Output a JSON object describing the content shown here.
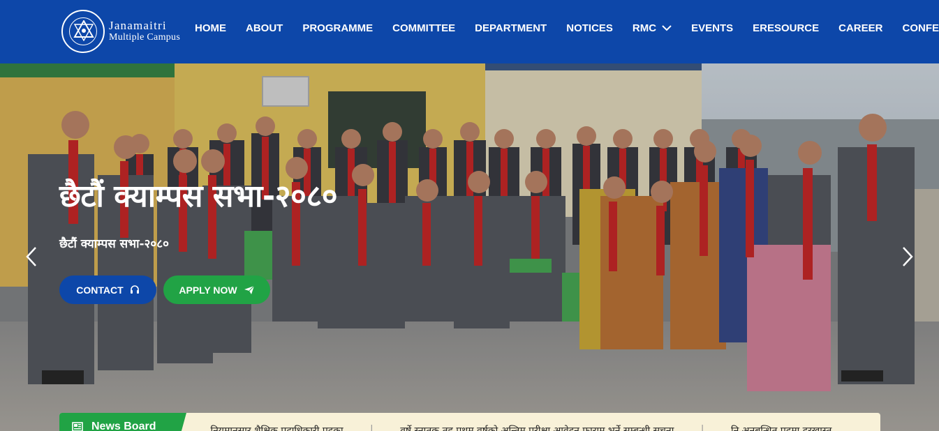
{
  "logo": {
    "line1": "Janamaitri",
    "line2": "Multiple Campus"
  },
  "nav": {
    "items": [
      "HOME",
      "ABOUT",
      "PROGRAMME",
      "COMMITTEE",
      "DEPARTMENT",
      "NOTICES",
      "RMC",
      "EVENTS",
      "ERESOURCE",
      "CAREER",
      "CONFERENCE"
    ]
  },
  "hero": {
    "title": "छैटौं क्याम्पस सभा-२०८०",
    "subtitle": "छैटौं क्याम्पस सभा-२०८०",
    "contact_label": "CONTACT",
    "apply_label": "APPLY NOW"
  },
  "news": {
    "label": "News Board",
    "items": [
      "… नियमानुसार शैक्षिक पदाधिकारी पदका …",
      "… वर्षे स्नातक तह प्रथम वर्षको अन्तिम परीक्षा आवेदन फाराम भर्ने सम्बन्धी सूचना …",
      "… नि.अनुबन्धित पदमा दरखास्त …"
    ]
  },
  "colors": {
    "brand_blue": "#0d47a9",
    "accent_green": "#21a345",
    "news_bg": "#f8f1d8"
  },
  "icons": {
    "contact": "headset-icon",
    "apply": "paper-plane-icon",
    "news": "newspaper-icon",
    "prev": "chevron-left-icon",
    "next": "chevron-right-icon",
    "dropdown": "chevron-down-icon"
  }
}
